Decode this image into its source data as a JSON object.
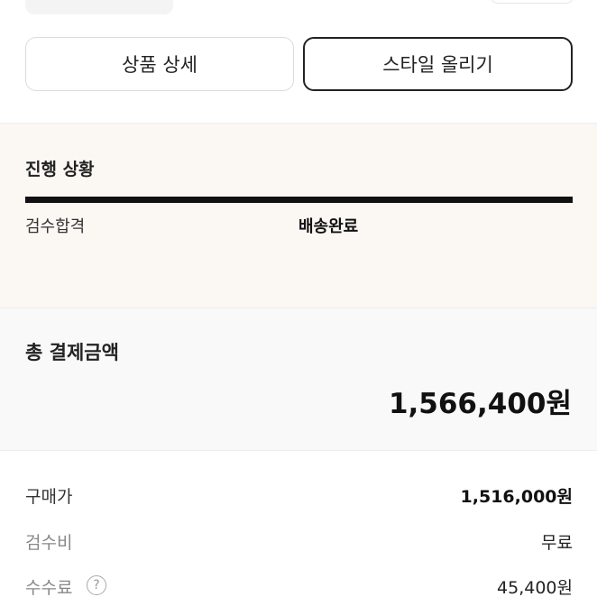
{
  "buttons": {
    "product_detail": "상품 상세",
    "upload_style": "스타일 올리기"
  },
  "progress": {
    "title": "진행 상황",
    "steps": [
      "검수합격",
      "배송완료"
    ],
    "current_step": "배송완료"
  },
  "total": {
    "title": "총 결제금액",
    "amount": "1,566,400원"
  },
  "details": [
    {
      "label": "구매가",
      "value": "1,516,000원"
    },
    {
      "label": "검수비",
      "value": "무료"
    },
    {
      "label": "수수료",
      "value": "45,400원",
      "help_icon": "?"
    }
  ],
  "colors": {
    "progress_background": "#fbf7f3",
    "total_background": "#f9f9f9",
    "progress_bar": "#111111"
  }
}
